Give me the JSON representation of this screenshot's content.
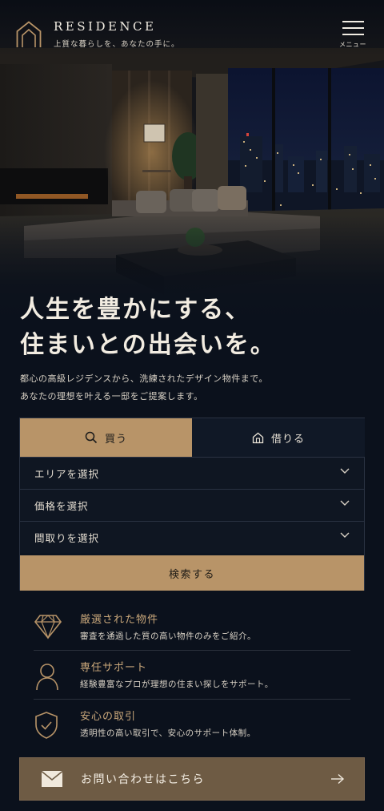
{
  "header": {
    "brand": "RESIDENCE",
    "tagline": "上質な暮らしを、あなたの手に。",
    "menu_label": "メニュー"
  },
  "hero": {
    "headline": "人生を豊かにする、\n住まいとの出会いを。",
    "subtext": "都心の高級レジデンスから、洗練されたデザイン物件まで。\nあなたの理想を叶える一邸をご提案します。"
  },
  "search": {
    "tabs": [
      {
        "label": "買う",
        "icon": "search-icon",
        "active": true
      },
      {
        "label": "借りる",
        "icon": "house-icon",
        "active": false
      }
    ],
    "fields": [
      {
        "label": "エリアを選択"
      },
      {
        "label": "価格を選択"
      },
      {
        "label": "間取りを選択"
      }
    ],
    "button_label": "検索する"
  },
  "features": [
    {
      "icon": "diamond-icon",
      "title": "厳選された物件",
      "description": "審査を通過した質の高い物件のみをご紹介。"
    },
    {
      "icon": "person-icon",
      "title": "専任サポート",
      "description": "経験豊富なプロが理想の住まい探しをサポート。"
    },
    {
      "icon": "shield-check-icon",
      "title": "安心の取引",
      "description": "透明性の高い取引で、安心のサポート体制。"
    }
  ],
  "contact": {
    "icon": "mail-icon",
    "label": "お問い合わせはこちら",
    "arrow_icon": "arrow-right-icon"
  },
  "colors": {
    "background": "#0b111c",
    "accent_gold": "#b89468",
    "feature_title": "#c9a77a",
    "contact_bg": "#6e5b44"
  }
}
